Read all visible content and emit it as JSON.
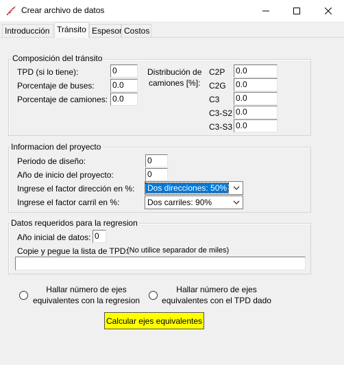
{
  "window": {
    "title": "Crear archivo de datos",
    "app_icon": "tk-feather-icon",
    "controls": [
      "minimize-icon",
      "maximize-icon",
      "close-icon"
    ]
  },
  "tabs": [
    {
      "label": "Introducción",
      "active": false
    },
    {
      "label": "Tránsito",
      "active": true
    },
    {
      "label": "Espesor",
      "active": false
    },
    {
      "label": "Costos",
      "active": false
    }
  ],
  "composicion": {
    "title": "Composición del tránsito",
    "tpd_label": "TPD (si lo tiene):",
    "tpd_value": "0",
    "buses_label": "Porcentaje de buses:",
    "buses_value": "0.0",
    "camiones_label": "Porcentaje de camiones:",
    "camiones_value": "0.0",
    "distribucion_label_1": "Distribución de",
    "distribucion_label_2": "camiones [%]:",
    "vehicles": [
      {
        "label": "C2P",
        "value": "0.0"
      },
      {
        "label": "C2G",
        "value": "0.0"
      },
      {
        "label": "C3",
        "value": "0.0"
      },
      {
        "label": "C3-S2",
        "value": "0.0"
      },
      {
        "label": "C3-S3",
        "value": "0.0"
      }
    ]
  },
  "proyecto": {
    "title": "Informacion del proyecto",
    "periodo_label": "Periodo de diseño:",
    "periodo_value": "0",
    "anio_label": "Año de inicio del proyecto:",
    "anio_value": "0",
    "direccion_label": "Ingrese el factor dirección en %:",
    "direccion_value": "Dos direcciones: 50%",
    "carril_label": "Ingrese el factor carril en %:",
    "carril_value": "Dos carriles: 90%"
  },
  "regresion": {
    "title": "Datos requeridos para la regresion",
    "anio_inicial_label": "Año inicial de datos:",
    "anio_inicial_value": "0",
    "copie_label": "Copie y pegue la lista de TPD:",
    "copie_note": "(No utilice separador de miles)",
    "tpd_list_value": ""
  },
  "options": {
    "radio1_line1": "Hallar número de ejes",
    "radio1_line2": "equivalentes con la regresion",
    "radio2_line1": "Hallar número de ejes",
    "radio2_line2": "equivalentes con el TPD dado"
  },
  "calc_button": "Calcular ejes equivalentes",
  "colors": {
    "button_bg": "#ffff00",
    "selection": "#0078d7",
    "window_bg": "#f0f0f0"
  }
}
